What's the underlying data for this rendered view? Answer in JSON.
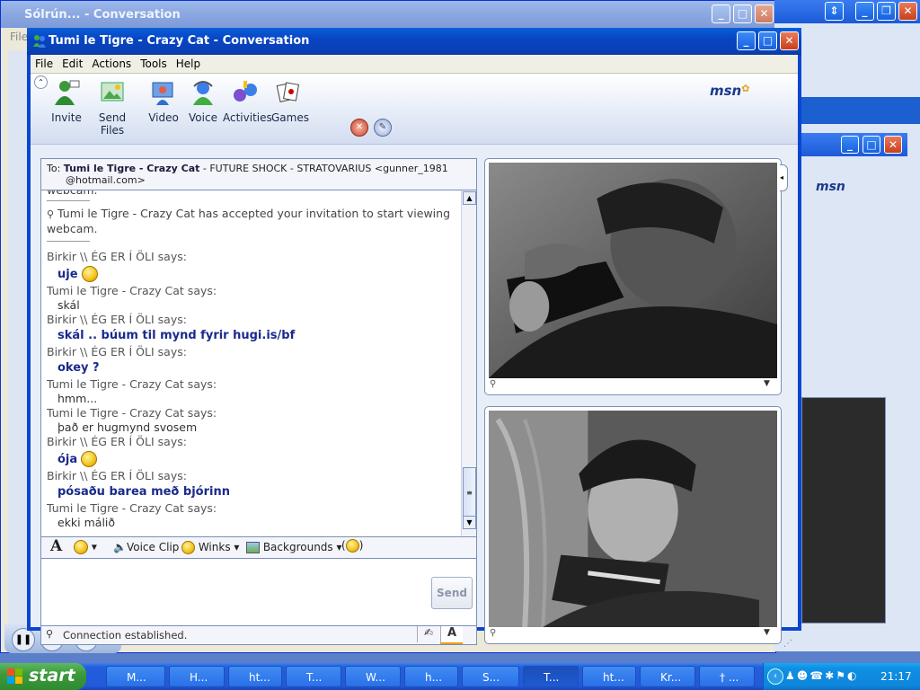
{
  "bg_window": {
    "title": "Sólrún... - Conversation",
    "menu_file": "File"
  },
  "window": {
    "title": "Tumi le Tigre - Crazy Cat - Conversation"
  },
  "menu": [
    "File",
    "Edit",
    "Actions",
    "Tools",
    "Help"
  ],
  "toolbar": {
    "items": [
      {
        "label": "Invite",
        "icon": "invite-icon"
      },
      {
        "label": "Send Files",
        "icon": "send-files-icon"
      },
      {
        "label": "Video",
        "icon": "video-icon"
      },
      {
        "label": "Voice",
        "icon": "voice-icon"
      },
      {
        "label": "Activities",
        "icon": "activities-icon"
      },
      {
        "label": "Games",
        "icon": "games-icon"
      }
    ],
    "brand": "msn"
  },
  "to": {
    "label": "To:",
    "name": "Tumi le Tigre - Crazy Cat",
    "rest": " - FUTURE SHOCK - STRATOVARIUS <gunner_1981",
    "line2": "@hotmail.com>"
  },
  "conversation": {
    "top_partial": "webcam.",
    "system": "Tumi le Tigre - Crazy Cat has accepted your invitation to start viewing",
    "system_line2": "webcam.",
    "messages": [
      {
        "speaker": "Birkir \\\\ ÉG ER Í ÖLI says:",
        "text": "uje",
        "mine": true,
        "emoticon": true
      },
      {
        "speaker": "Tumi le Tigre - Crazy Cat says:",
        "text": "skál",
        "mine": false
      },
      {
        "speaker": "Birkir \\\\ ÉG ER Í ÖLI says:",
        "text": "skál .. búum til mynd fyrir hugi.is/bf",
        "mine": true
      },
      {
        "speaker": "Birkir \\\\ ÉG ER Í ÖLI says:",
        "text": "okey ?",
        "mine": true
      },
      {
        "speaker": "Tumi le Tigre - Crazy Cat says:",
        "text": "hmm...",
        "mine": false
      },
      {
        "speaker": "Tumi le Tigre - Crazy Cat says:",
        "text": "það er hugmynd svosem",
        "mine": false
      },
      {
        "speaker": "Birkir \\\\ ÉG ER Í ÖLI says:",
        "text": "ója",
        "mine": true,
        "emoticon": true
      },
      {
        "speaker": "Birkir \\\\ ÉG ER Í ÖLI says:",
        "text": "pósaðu barea með bjórinn",
        "mine": true
      },
      {
        "speaker": "Tumi le Tigre - Crazy Cat says:",
        "text": "ekki málið",
        "mine": false
      }
    ]
  },
  "input_toolbar": {
    "font_label": "A",
    "voice_clip": "Voice Clip",
    "winks": "Winks",
    "backgrounds": "Backgrounds"
  },
  "send_button": "Send",
  "status": "Connection established.",
  "bg_right_brand": "msn",
  "taskbar": {
    "start": "start",
    "items": [
      "M...",
      "H...",
      "ht...",
      "T...",
      "W...",
      "h...",
      "S...",
      "T...",
      "ht...",
      "Kr...",
      "† ..."
    ],
    "active_index": 7,
    "clock": "21:17"
  }
}
